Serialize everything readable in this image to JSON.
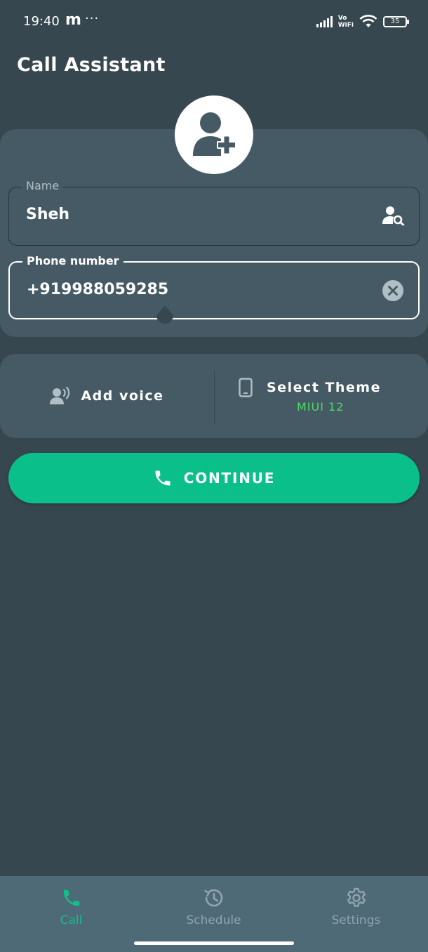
{
  "status_bar": {
    "time": "19:40",
    "app_letter": "m",
    "more": "···",
    "network_line1": "Vo",
    "network_line2": "WiFi",
    "battery": "35"
  },
  "header": {
    "title": "Call Assistant"
  },
  "contact": {
    "avatar_icon": "add-person-icon",
    "name_field": {
      "label": "Name",
      "value": "Sheh",
      "icon": "person-search-icon"
    },
    "phone_field": {
      "label": "Phone number",
      "value": "+919988059285",
      "icon": "clear-icon"
    }
  },
  "options": {
    "voice": {
      "label": "Add voice",
      "icon": "voice-person-icon"
    },
    "theme": {
      "label": "Select Theme",
      "value": "MIUI 12",
      "icon": "phone-device-icon"
    }
  },
  "continue_button": {
    "label": "CONTINUE",
    "icon": "phone-icon"
  },
  "bottom_nav": {
    "items": [
      {
        "label": "Call",
        "icon": "phone-icon",
        "active": true
      },
      {
        "label": "Schedule",
        "icon": "clock-history-icon",
        "active": false
      },
      {
        "label": "Settings",
        "icon": "gear-icon",
        "active": false
      }
    ]
  },
  "colors": {
    "background": "#37474f",
    "card": "#455a64",
    "accent": "#0bbf8b",
    "theme_value": "#4cd964",
    "nav_bar": "#4e6a76"
  }
}
